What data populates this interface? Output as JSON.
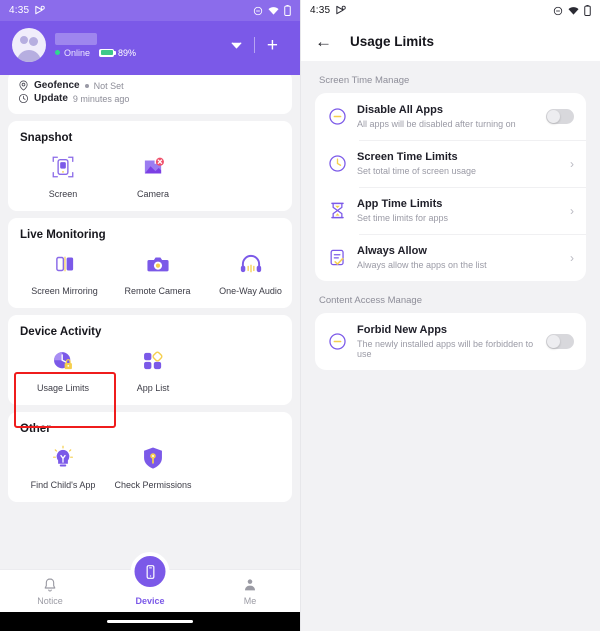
{
  "theme": {
    "purple": "#7b59e8",
    "purple_status": "#8b6ceb",
    "accent_yellow": "#f5cf4e",
    "online_green": "#2fd98f",
    "highlight_red": "#ef1c1c",
    "page_bg": "#f2f2f4"
  },
  "left": {
    "status_bar": {
      "time": "4:35",
      "icons": [
        "play-badge-icon",
        "do-not-disturb-icon",
        "wifi-icon",
        "battery-icon"
      ]
    },
    "hero": {
      "device_name": "",
      "online_label": "Online",
      "battery_label": "89%",
      "caret_icon": "chevron-down-icon",
      "add_icon": "plus-icon"
    },
    "info": {
      "geofence_label": "Geofence",
      "geofence_value": "Not Set",
      "update_label": "Update",
      "update_value": "9 minutes ago"
    },
    "sections": [
      {
        "title": "Snapshot",
        "tiles": [
          {
            "label": "Screen",
            "icon": "screen-snapshot-icon"
          },
          {
            "label": "Camera",
            "icon": "camera-snapshot-icon",
            "badge": "error-badge-icon"
          }
        ]
      },
      {
        "title": "Live Monitoring",
        "tiles": [
          {
            "label": "Screen Mirroring",
            "icon": "screen-mirroring-icon"
          },
          {
            "label": "Remote Camera",
            "icon": "remote-camera-icon"
          },
          {
            "label": "One-Way Audio",
            "icon": "headphones-icon"
          }
        ]
      },
      {
        "title": "Device Activity",
        "tiles": [
          {
            "label": "Usage Limits",
            "icon": "clock-lock-icon",
            "highlighted": true
          },
          {
            "label": "App List",
            "icon": "app-grid-icon"
          }
        ]
      },
      {
        "title": "Other",
        "tiles": [
          {
            "label": "Find Child's App",
            "icon": "lightbulb-icon"
          },
          {
            "label": "Check Permissions",
            "icon": "shield-key-icon"
          }
        ]
      }
    ],
    "bottom_nav": [
      {
        "label": "Notice",
        "icon": "bell-icon",
        "active": false
      },
      {
        "label": "Device",
        "icon": "phone-icon",
        "active": true
      },
      {
        "label": "Me",
        "icon": "person-icon",
        "active": false
      }
    ]
  },
  "right": {
    "status_bar": {
      "time": "4:35",
      "icons": [
        "play-badge-icon",
        "do-not-disturb-icon",
        "wifi-icon",
        "battery-icon"
      ]
    },
    "app_bar": {
      "back_icon": "back-arrow-icon",
      "title": "Usage Limits"
    },
    "groups": [
      {
        "label": "Screen Time Manage",
        "rows": [
          {
            "title": "Disable All Apps",
            "subtitle": "All apps will be disabled after turning on",
            "icon": "minus-circle-icon",
            "control": "toggle",
            "toggle_on": false
          },
          {
            "title": "Screen Time Limits",
            "subtitle": "Set total time of screen usage",
            "icon": "clock-icon",
            "control": "chevron",
            "chevron": "›"
          },
          {
            "title": "App Time Limits",
            "subtitle": "Set time limits for apps",
            "icon": "hourglass-icon",
            "control": "chevron",
            "chevron": "›"
          },
          {
            "title": "Always Allow",
            "subtitle": "Always allow the apps on the list",
            "icon": "checklist-icon",
            "control": "chevron",
            "chevron": "›"
          }
        ]
      },
      {
        "label": "Content Access Manage",
        "rows": [
          {
            "title": "Forbid New Apps",
            "subtitle": "The newly installed apps will be forbidden to use",
            "icon": "minus-circle-icon",
            "control": "toggle",
            "toggle_on": false
          }
        ]
      }
    ]
  }
}
